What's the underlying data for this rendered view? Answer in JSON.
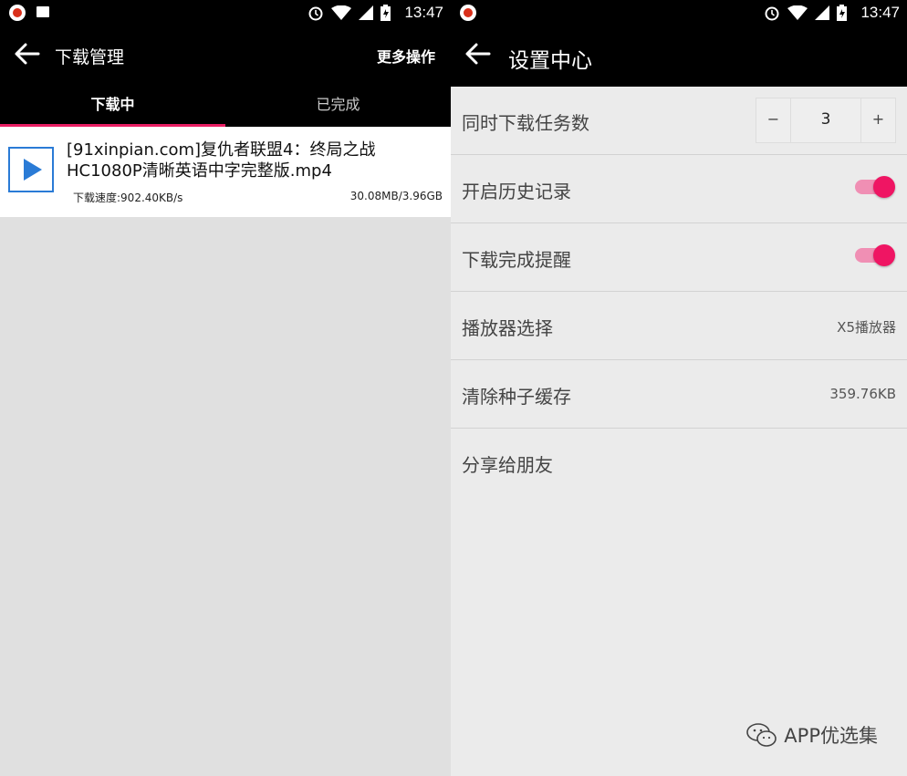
{
  "status_bar": {
    "time": "13:47"
  },
  "left": {
    "title": "下载管理",
    "more_label": "更多操作",
    "tabs": [
      {
        "label": "下载中",
        "active": true
      },
      {
        "label": "已完成",
        "active": false
      }
    ],
    "downloads": [
      {
        "name": "[91xinpian.com]复仇者联盟4：终局之战HC1080P清晰英语中字完整版.mp4",
        "speed": "下载速度:902.40KB/s",
        "size": "30.08MB/3.96GB"
      }
    ]
  },
  "right": {
    "title": "设置中心",
    "settings": {
      "concurrent": {
        "label": "同时下载任务数",
        "value": "3",
        "minus": "−",
        "plus": "+"
      },
      "history": {
        "label": "开启历史记录",
        "enabled": true
      },
      "notify": {
        "label": "下载完成提醒",
        "enabled": true
      },
      "player": {
        "label": "播放器选择",
        "value": "X5播放器"
      },
      "cache": {
        "label": "清除种子缓存",
        "value": "359.76KB"
      },
      "share": {
        "label": "分享给朋友"
      }
    }
  },
  "watermark": {
    "text": "APP优选集"
  },
  "colors": {
    "accent": "#e91e63",
    "toggle_knob": "#ef1563",
    "play_blue": "#2a7bd6"
  }
}
